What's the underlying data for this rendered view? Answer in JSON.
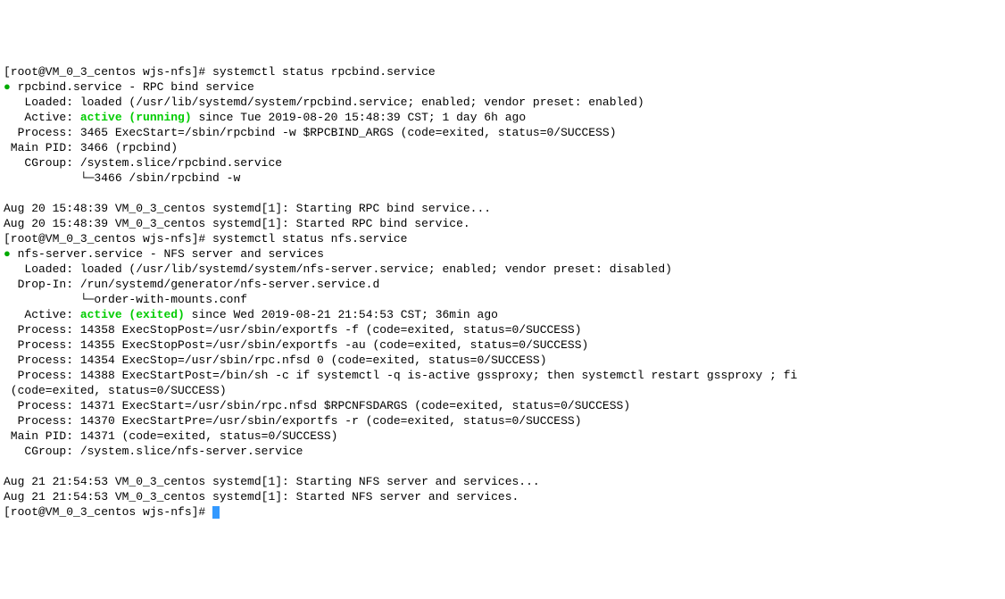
{
  "lines": [
    {
      "segments": [
        {
          "text": "[root@VM_0_3_centos wjs-nfs]# "
        },
        {
          "text": "systemctl status rpcbind.service"
        }
      ]
    },
    {
      "segments": [
        {
          "text": "●",
          "cls": "bullet"
        },
        {
          "text": " rpcbind.service - RPC bind service"
        }
      ]
    },
    {
      "segments": [
        {
          "text": "   Loaded: loaded (/usr/lib/systemd/system/rpcbind.service; enabled; vendor preset: enabled)"
        }
      ]
    },
    {
      "segments": [
        {
          "text": "   Active: "
        },
        {
          "text": "active (running)",
          "cls": "green"
        },
        {
          "text": " since Tue 2019-08-20 15:48:39 CST; 1 day 6h ago"
        }
      ]
    },
    {
      "segments": [
        {
          "text": "  Process: 3465 ExecStart=/sbin/rpcbind -w $RPCBIND_ARGS (code=exited, status=0/SUCCESS)"
        }
      ]
    },
    {
      "segments": [
        {
          "text": " Main PID: 3466 (rpcbind)"
        }
      ]
    },
    {
      "segments": [
        {
          "text": "   CGroup: /system.slice/rpcbind.service"
        }
      ]
    },
    {
      "segments": [
        {
          "text": "           └─3466 /sbin/rpcbind -w"
        }
      ]
    },
    {
      "segments": [
        {
          "text": " "
        }
      ]
    },
    {
      "segments": [
        {
          "text": "Aug 20 15:48:39 VM_0_3_centos systemd[1]: Starting RPC bind service..."
        }
      ]
    },
    {
      "segments": [
        {
          "text": "Aug 20 15:48:39 VM_0_3_centos systemd[1]: Started RPC bind service."
        }
      ]
    },
    {
      "segments": [
        {
          "text": "[root@VM_0_3_centos wjs-nfs]# "
        },
        {
          "text": "systemctl status nfs.service"
        }
      ]
    },
    {
      "segments": [
        {
          "text": "●",
          "cls": "bullet"
        },
        {
          "text": " nfs-server.service - NFS server and services"
        }
      ]
    },
    {
      "segments": [
        {
          "text": "   Loaded: loaded (/usr/lib/systemd/system/nfs-server.service; enabled; vendor preset: disabled)"
        }
      ]
    },
    {
      "segments": [
        {
          "text": "  Drop-In: /run/systemd/generator/nfs-server.service.d"
        }
      ]
    },
    {
      "segments": [
        {
          "text": "           └─order-with-mounts.conf"
        }
      ]
    },
    {
      "segments": [
        {
          "text": "   Active: "
        },
        {
          "text": "active (exited)",
          "cls": "green"
        },
        {
          "text": " since Wed 2019-08-21 21:54:53 CST; 36min ago"
        }
      ]
    },
    {
      "segments": [
        {
          "text": "  Process: 14358 ExecStopPost=/usr/sbin/exportfs -f (code=exited, status=0/SUCCESS)"
        }
      ]
    },
    {
      "segments": [
        {
          "text": "  Process: 14355 ExecStopPost=/usr/sbin/exportfs -au (code=exited, status=0/SUCCESS)"
        }
      ]
    },
    {
      "segments": [
        {
          "text": "  Process: 14354 ExecStop=/usr/sbin/rpc.nfsd 0 (code=exited, status=0/SUCCESS)"
        }
      ]
    },
    {
      "segments": [
        {
          "text": "  Process: 14388 ExecStartPost=/bin/sh -c if systemctl -q is-active gssproxy; then systemctl restart gssproxy ; fi"
        }
      ]
    },
    {
      "segments": [
        {
          "text": " (code=exited, status=0/SUCCESS)"
        }
      ]
    },
    {
      "segments": [
        {
          "text": "  Process: 14371 ExecStart=/usr/sbin/rpc.nfsd $RPCNFSDARGS (code=exited, status=0/SUCCESS)"
        }
      ]
    },
    {
      "segments": [
        {
          "text": "  Process: 14370 ExecStartPre=/usr/sbin/exportfs -r (code=exited, status=0/SUCCESS)"
        }
      ]
    },
    {
      "segments": [
        {
          "text": " Main PID: 14371 (code=exited, status=0/SUCCESS)"
        }
      ]
    },
    {
      "segments": [
        {
          "text": "   CGroup: /system.slice/nfs-server.service"
        }
      ]
    },
    {
      "segments": [
        {
          "text": " "
        }
      ]
    },
    {
      "segments": [
        {
          "text": "Aug 21 21:54:53 VM_0_3_centos systemd[1]: Starting NFS server and services..."
        }
      ]
    },
    {
      "segments": [
        {
          "text": "Aug 21 21:54:53 VM_0_3_centos systemd[1]: Started NFS server and services."
        }
      ]
    },
    {
      "segments": [
        {
          "text": "[root@VM_0_3_centos wjs-nfs]# "
        }
      ],
      "cursor": true
    }
  ]
}
